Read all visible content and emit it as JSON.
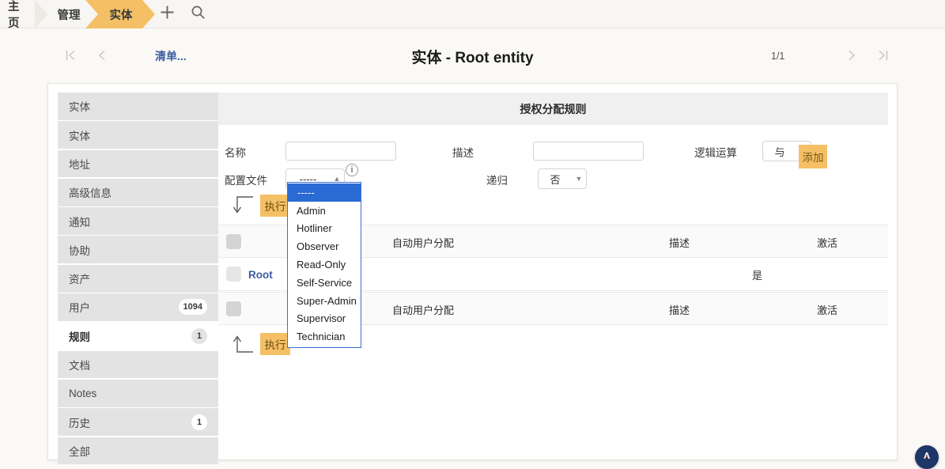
{
  "topbar": {
    "crumbs": [
      {
        "label": "主页",
        "active": false
      },
      {
        "label": "管理",
        "active": false
      },
      {
        "label": "实体",
        "active": true
      }
    ],
    "plus_icon": "plus-icon",
    "search_icon": "search-icon",
    "active_color": "#f5c065"
  },
  "recnav": {
    "first_icon": "first-page-icon",
    "prev_icon": "prev-page-icon",
    "list_link": "清单...",
    "title": "实体 - Root entity",
    "page_count": "1/1",
    "next_icon": "next-page-icon",
    "last_icon": "last-page-icon"
  },
  "sidebar": {
    "items": [
      {
        "label": "实体",
        "badge": "",
        "active": false
      },
      {
        "label": "实体",
        "badge": "",
        "active": false
      },
      {
        "label": "地址",
        "badge": "",
        "active": false
      },
      {
        "label": "高级信息",
        "badge": "",
        "active": false
      },
      {
        "label": "通知",
        "badge": "",
        "active": false
      },
      {
        "label": "协助",
        "badge": "",
        "active": false
      },
      {
        "label": "资产",
        "badge": "",
        "active": false
      },
      {
        "label": "用户",
        "badge": "1094",
        "active": false
      },
      {
        "label": "规则",
        "badge": "1",
        "active": true
      },
      {
        "label": "文档",
        "badge": "",
        "active": false
      },
      {
        "label": "Notes",
        "badge": "",
        "active": false
      },
      {
        "label": "历史",
        "badge": "1",
        "active": false
      },
      {
        "label": "全部",
        "badge": "",
        "active": false
      }
    ]
  },
  "panel": {
    "title": "授权分配规则",
    "form": {
      "name_label": "名称",
      "name_value": "",
      "name_placeholder": "",
      "desc_label": "描述",
      "desc_value": "",
      "desc_placeholder": "",
      "logic_label": "逻辑运算",
      "logic_value": "与",
      "profile_label": "配置文件",
      "profile_value": "-----",
      "info_icon": "info-icon",
      "recursive_label": "递归",
      "recursive_value": "否",
      "add_label": "添加"
    },
    "profile_dropdown": {
      "open": true,
      "options": [
        {
          "label": "-----",
          "selected": true
        },
        {
          "label": "Admin",
          "selected": false
        },
        {
          "label": "Hotliner",
          "selected": false
        },
        {
          "label": "Observer",
          "selected": false
        },
        {
          "label": "Read-Only",
          "selected": false
        },
        {
          "label": "Self-Service",
          "selected": false
        },
        {
          "label": "Super-Admin",
          "selected": false
        },
        {
          "label": "Supervisor",
          "selected": false
        },
        {
          "label": "Technician",
          "selected": false
        }
      ]
    },
    "exec_top": {
      "arrow_icon": "arrow-down-branch-icon",
      "label": "执行"
    },
    "exec_bottom": {
      "arrow_icon": "arrow-up-branch-icon",
      "label": "执行"
    },
    "table_top": {
      "headers": [
        "自动用户分配",
        "描述",
        "激活"
      ],
      "rows": [
        {
          "name": "Root",
          "desc": "",
          "active": "是"
        }
      ]
    },
    "table_bottom": {
      "headers": [
        "自动用户分配",
        "描述",
        "激活"
      ]
    }
  },
  "fab": {
    "icon": "assistant-logo-icon"
  }
}
